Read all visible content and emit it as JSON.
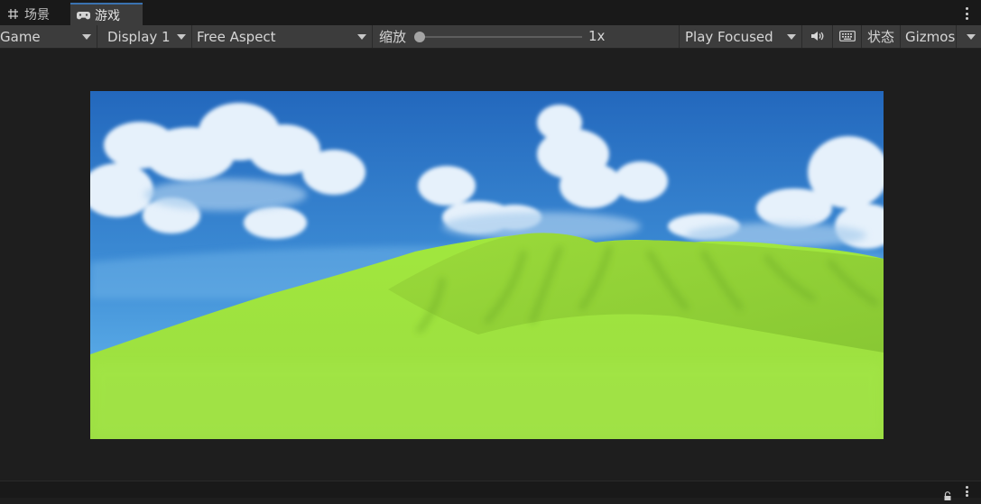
{
  "tabs": [
    {
      "label": "场景",
      "icon": "hash-grid-icon",
      "active": false
    },
    {
      "label": "游戏",
      "icon": "gamepad-icon",
      "active": true
    }
  ],
  "toolbar": {
    "view_dropdown": "Game",
    "display_dropdown": "Display 1",
    "aspect_dropdown": "Free Aspect",
    "zoom_label": "缩放",
    "zoom_value": "1x",
    "zoom_level": 1,
    "play_mode_dropdown": "Play Focused",
    "mute_icon": "speaker-icon",
    "keyboard_icon": "keyboard-icon",
    "stats_button": "状态",
    "gizmos_dropdown": "Gizmos"
  },
  "colors": {
    "panel_bg": "#1e1e1e",
    "toolbar_bg": "#3c3c3c",
    "tab_active_accent": "#3a72b0",
    "sky_top": "#2368bd",
    "sky_bottom": "#55a6e4",
    "grass_light": "#a7ec46",
    "grass_dark": "#84c92f"
  }
}
